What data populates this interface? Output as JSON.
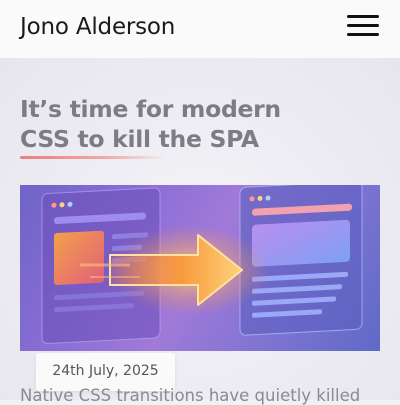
{
  "header": {
    "site_title": "Jono Alderson"
  },
  "article": {
    "title_line_1": "It’s time for modern",
    "title_line_2": "CSS to kill the SPA",
    "date": "24th July, 2025",
    "intro": "Native CSS transitions have quietly killed"
  },
  "icons": {
    "menu": "hamburger-menu-icon",
    "hero": "page-transition-illustration"
  },
  "colors": {
    "title_underline": "#e8807c",
    "hero_arrow": "#f7a23c"
  }
}
